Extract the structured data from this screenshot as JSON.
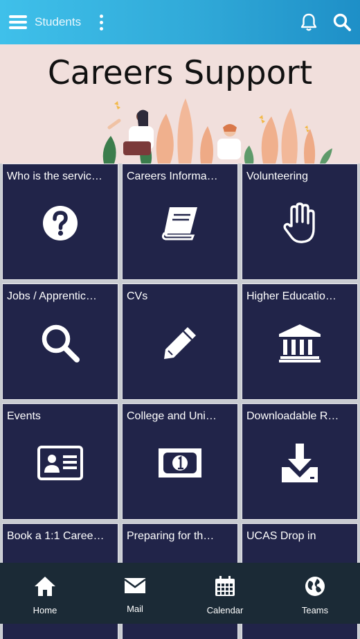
{
  "topbar": {
    "title": "Students",
    "icons": [
      "menu-icon",
      "more-vertical-icon",
      "bell-icon",
      "search-icon"
    ]
  },
  "banner": {
    "title": "Careers Support"
  },
  "tiles": [
    {
      "label": "Who is the servic…",
      "icon": "question-circle-icon"
    },
    {
      "label": "Careers Informa…",
      "icon": "book-icon"
    },
    {
      "label": "Volunteering",
      "icon": "hand-icon"
    },
    {
      "label": "Jobs / Apprentic…",
      "icon": "magnifier-icon"
    },
    {
      "label": "CVs",
      "icon": "pencil-icon"
    },
    {
      "label": "Higher Educatio…",
      "icon": "institution-icon"
    },
    {
      "label": "Events",
      "icon": "id-card-icon"
    },
    {
      "label": "College and Uni…",
      "icon": "banknote-icon"
    },
    {
      "label": "Downloadable R…",
      "icon": "download-icon"
    },
    {
      "label": "Book a 1:1 Caree…",
      "icon": "calendar-icon"
    },
    {
      "label": "Preparing for th…",
      "icon": "pencil-icon"
    },
    {
      "label": "UCAS Drop in",
      "icon": "info-icon"
    }
  ],
  "bottom_nav": [
    {
      "label": "Home",
      "icon": "home-icon"
    },
    {
      "label": "Mail",
      "icon": "mail-icon"
    },
    {
      "label": "Calendar",
      "icon": "calendar-icon"
    },
    {
      "label": "Teams",
      "icon": "globe-icon"
    }
  ],
  "colors": {
    "topbar_start": "#3fc0ea",
    "topbar_end": "#1e8fc7",
    "banner_bg": "#f1dfdc",
    "tile_bg": "#212449",
    "nav_bg": "#1b2a36"
  }
}
